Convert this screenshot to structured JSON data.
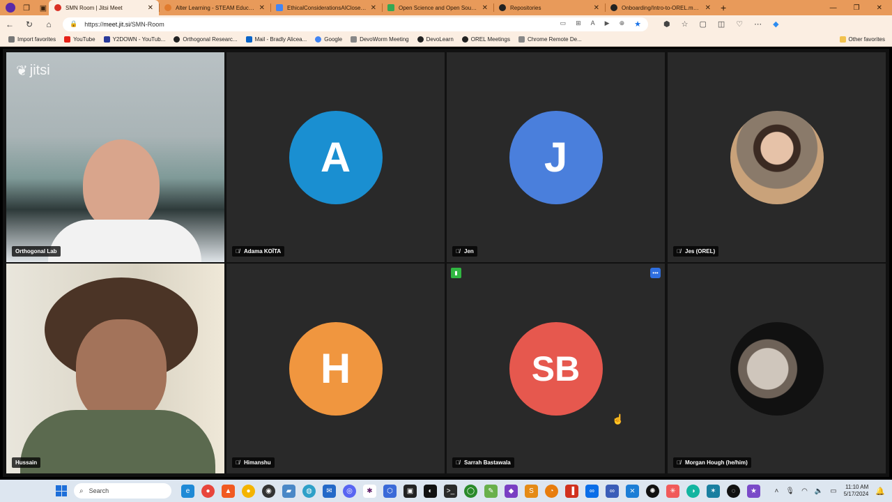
{
  "browser": {
    "tabs": [
      {
        "title": "SMN Room | Jitsi Meet",
        "favicon_color": "#d93025",
        "active": true
      },
      {
        "title": "Alter Learning - STEAM Educatio",
        "favicon_color": "#e07b2e",
        "active": false
      },
      {
        "title": "EthicalConsiderationsAIClosedLo",
        "favicon_color": "#4285f4",
        "active": false
      },
      {
        "title": "Open Science and Open Source",
        "favicon_color": "#34a853",
        "active": false
      },
      {
        "title": "Repositories",
        "favicon_color": "#222222",
        "active": false
      },
      {
        "title": "Onboarding/Intro-to-OREL.md a",
        "favicon_color": "#222222",
        "active": false
      }
    ],
    "address": {
      "scheme": "https://",
      "host": "meet.jit.si",
      "path": "/SMN-Room"
    },
    "bookmarks": [
      {
        "label": "Import favorites",
        "color": "#777777"
      },
      {
        "label": "YouTube",
        "color": "#e62117"
      },
      {
        "label": "Y2DOWN - YouTub...",
        "color": "#2a3a9a"
      },
      {
        "label": "Orthogonal Researc...",
        "color": "#222222"
      },
      {
        "label": "Mail - Bradly Alicea...",
        "color": "#0a64c8"
      },
      {
        "label": "Google",
        "color": "#4285f4"
      },
      {
        "label": "DevoWorm Meeting",
        "color": "#888888"
      },
      {
        "label": "DevoLearn",
        "color": "#222222"
      },
      {
        "label": "OREL Meetings",
        "color": "#222222"
      },
      {
        "label": "Chrome Remote De...",
        "color": "#888888"
      }
    ],
    "other_favorites": "Other favorites"
  },
  "meeting": {
    "logo": "jitsi",
    "participants": [
      {
        "name": "Orthogonal Lab",
        "type": "video",
        "muted": false
      },
      {
        "name": "Adama KOÏTA",
        "type": "avatar",
        "initials": "A",
        "color": "#1a8fd1",
        "muted": true
      },
      {
        "name": "Jen",
        "type": "avatar",
        "initials": "J",
        "color": "#4a7fdc",
        "muted": true
      },
      {
        "name": "Jes (OREL)",
        "type": "photo",
        "muted": true
      },
      {
        "name": "Hussain",
        "type": "video",
        "muted": false,
        "selected": true
      },
      {
        "name": "Himanshu",
        "type": "avatar",
        "initials": "H",
        "color": "#f0963f",
        "muted": true
      },
      {
        "name": "Sarrah Bastawala",
        "type": "avatar",
        "initials": "SB",
        "color": "#e6584e",
        "muted": true
      },
      {
        "name": "Morgan Hough (he/him)",
        "type": "photo",
        "muted": true
      }
    ]
  },
  "taskbar": {
    "search_placeholder": "Search",
    "time": "11:10 AM",
    "date": "5/17/2024"
  }
}
